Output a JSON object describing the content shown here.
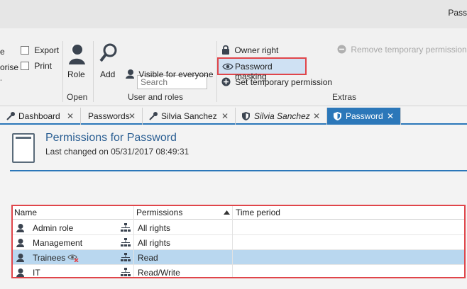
{
  "titlebar": {
    "title": "Pass"
  },
  "ribbon": {
    "left_partial_1": "e",
    "left_partial_2": "orise",
    "left_partial_3": "-",
    "export_label": "Export",
    "print_label": "Print",
    "role_label": "Role",
    "open_group": "Open",
    "add_label": "Add",
    "search_placeholder": "Search",
    "visible_label": "Visible for everyone",
    "user_roles_group": "User and roles",
    "owner_right_label": "Owner right",
    "password_masking_label": "Password masking",
    "set_temp_label": "Set temporary permission",
    "remove_temp_label": "Remove temporary permission",
    "extras_group": "Extras"
  },
  "tabs": [
    {
      "label": "Dashboard",
      "close": "✕",
      "icon": "key-icon"
    },
    {
      "label": "Passwords",
      "close": "✕"
    },
    {
      "label": "Silvia Sanchez",
      "close": "✕",
      "icon": "key-icon"
    },
    {
      "label": "Silvia Sanchez",
      "close": "✕",
      "icon": "shield-icon"
    },
    {
      "label": "Password",
      "close": "✕",
      "icon": "shield-icon",
      "active": true
    }
  ],
  "permissions": {
    "title": "Permissions for Password",
    "last_changed": "Last changed on 05/31/2017 08:49:31"
  },
  "grid": {
    "columns": [
      "Name",
      "Permissions",
      "Time period"
    ],
    "rows": [
      {
        "name": "Admin role",
        "permission": "All rights",
        "time": "",
        "selected": false
      },
      {
        "name": "Management",
        "permission": "All rights",
        "time": "",
        "selected": false
      },
      {
        "name": "Trainees",
        "permission": "Read",
        "time": "",
        "selected": true,
        "masked": true
      },
      {
        "name": "IT",
        "permission": "Read/Write",
        "time": "",
        "selected": false
      }
    ]
  },
  "colors": {
    "accent": "#2b77b9",
    "highlight": "#e0454a",
    "selected_row": "#b9d7ef"
  }
}
